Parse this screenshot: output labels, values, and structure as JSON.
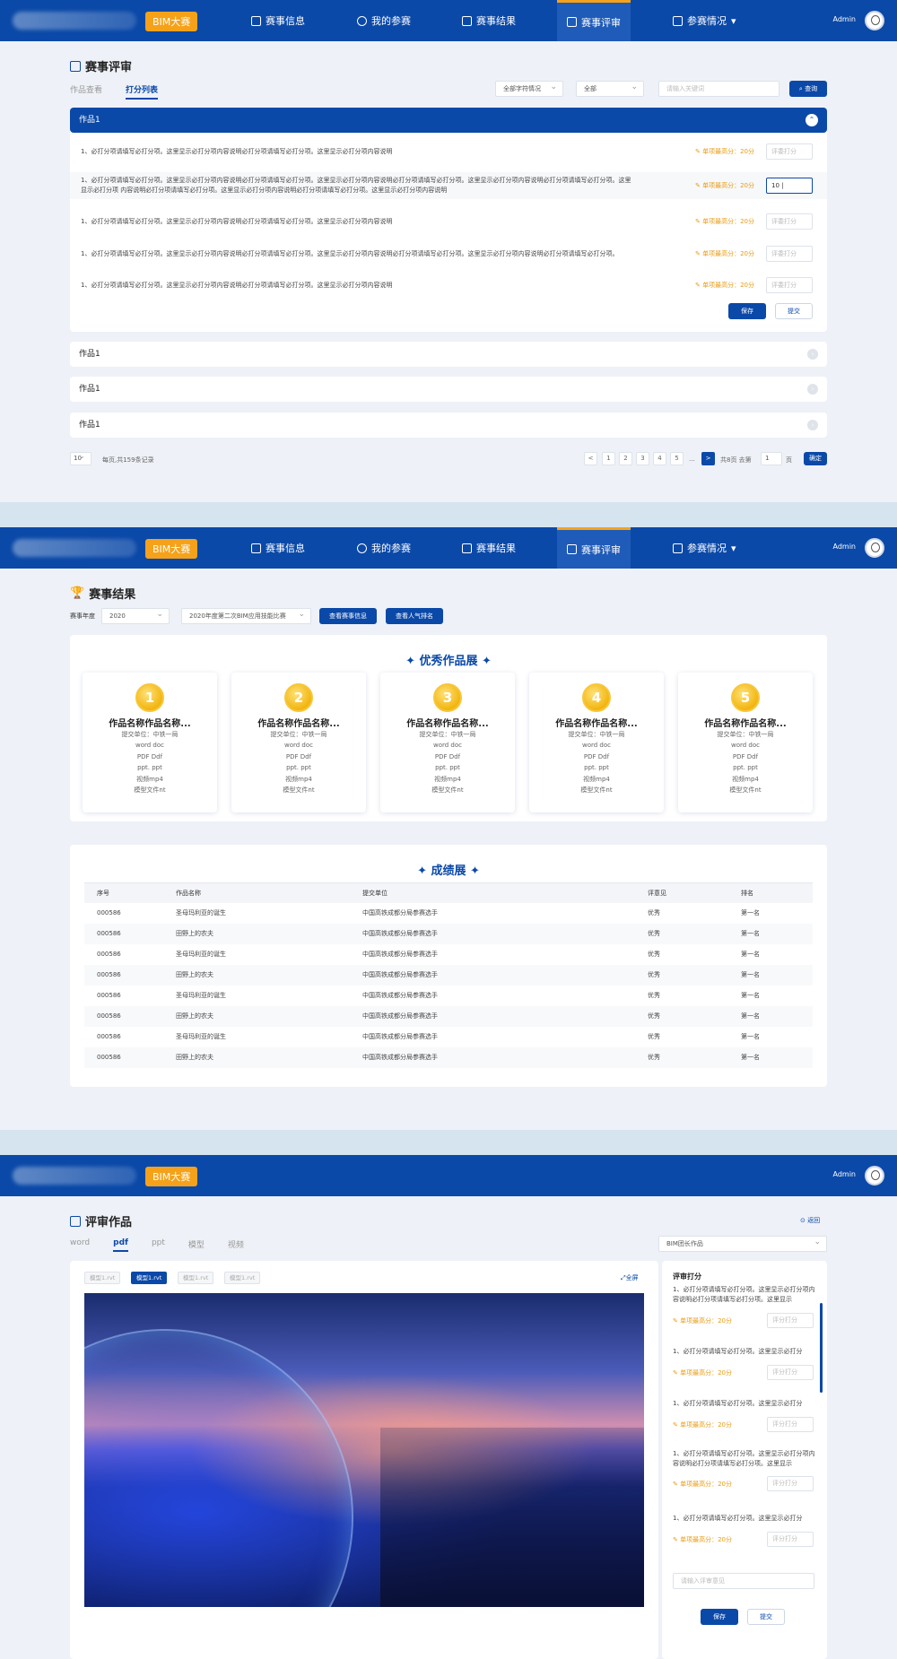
{
  "nav": {
    "badge": "BIM大赛",
    "items": [
      "赛事信息",
      "我的参赛",
      "赛事结果",
      "赛事评审",
      "参赛情况"
    ],
    "admin": "Admin"
  },
  "s1": {
    "title": "赛事评审",
    "tabs": [
      "作品查看",
      "打分列表"
    ],
    "filter1": "全部字符情况",
    "filter2": "全部",
    "search_ph": "请输入关键词",
    "search_btn": "查询",
    "open": "作品1",
    "rows": [
      {
        "text": "1、必打分项请填写必打分项。这里显示必打分项内容说明必打分项请填写必打分项。这里显示必打分项内容说明",
        "max": "单项最高分：20分",
        "score": "评委打分"
      },
      {
        "text": "1、必打分项请填写必打分项。这里显示必打分项内容说明必打分项请填写必打分项。这里显示必打分项内容说明必打分项请填写必打分项。这里显示必打分项内容说明必打分项请填写必打分项。这里显示必打分项 内容说明必打分项请填写必打分项。这里显示必打分项内容说明必打分项请填写必打分项。这里显示必打分项内容说明",
        "max": "单项最高分：20分",
        "score": "10 |"
      },
      {
        "text": "1、必打分项请填写必打分项。这里显示必打分项内容说明必打分项请填写必打分项。这里显示必打分项内容说明",
        "max": "单项最高分：20分",
        "score": "评委打分"
      },
      {
        "text": "1、必打分项请填写必打分项。这里显示必打分项内容说明必打分项请填写必打分项。这里显示必打分项内容说明必打分项请填写必打分项。这里显示必打分项内容说明必打分项请填写必打分项。",
        "max": "单项最高分：20分",
        "score": "评委打分"
      },
      {
        "text": "1、必打分项请填写必打分项。这里显示必打分项内容说明必打分项请填写必打分项。这里显示必打分项内容说明",
        "max": "单项最高分：20分",
        "score": "评委打分"
      }
    ],
    "save": "保存",
    "submit": "提交",
    "closed": [
      "作品1",
      "作品1",
      "作品1"
    ],
    "page_size": "10",
    "total_text": "每页,共159条记录",
    "pages": [
      "<",
      "1",
      "2",
      "3",
      "4",
      "5",
      "...",
      ">"
    ],
    "total_pages": "共8页 去第",
    "goto": "1",
    "page_unit": "页",
    "confirm": "确定"
  },
  "s2": {
    "title": "赛事结果",
    "year_label": "赛事年度",
    "year": "2020",
    "contest": "2020年度第二次BIM应用技能比赛",
    "btn1": "查看赛事信息",
    "btn2": "查看人气排名",
    "sec1": "优秀作品展",
    "medals": [
      {
        "rank": "1",
        "name": "作品名称作品名称...",
        "unit": "提交单位：中铁一局",
        "files": [
          "word doc",
          "PDF Ddf",
          "ppt. ppt",
          "视频mp4",
          "模型文件nt"
        ]
      },
      {
        "rank": "2",
        "name": "作品名称作品名称...",
        "unit": "提交单位：中铁一局",
        "files": [
          "word doc",
          "PDF Ddf",
          "ppt. ppt",
          "视频mp4",
          "模型文件nt"
        ]
      },
      {
        "rank": "3",
        "name": "作品名称作品名称...",
        "unit": "提交单位：中铁一局",
        "files": [
          "word doc",
          "PDF Ddf",
          "ppt. ppt",
          "视频mp4",
          "模型文件nt"
        ]
      },
      {
        "rank": "4",
        "name": "作品名称作品名称...",
        "unit": "提交单位：中铁一局",
        "files": [
          "word doc",
          "PDF Ddf",
          "ppt. ppt",
          "视频mp4",
          "模型文件nt"
        ]
      },
      {
        "rank": "5",
        "name": "作品名称作品名称...",
        "unit": "提交单位：中铁一局",
        "files": [
          "word doc",
          "PDF Ddf",
          "ppt. ppt",
          "视频mp4",
          "模型文件nt"
        ]
      }
    ],
    "sec2": "成绩展",
    "cols": [
      "序号",
      "作品名称",
      "提交单位",
      "评意见",
      "排名"
    ],
    "rows": [
      [
        "000586",
        "圣母玛利亚的诞生",
        "中国高铁成都分局参赛选手",
        "优秀",
        "第一名"
      ],
      [
        "000586",
        "田野上的农夫",
        "中国高铁成都分局参赛选手",
        "优秀",
        "第一名"
      ],
      [
        "000586",
        "圣母玛利亚的诞生",
        "中国高铁成都分局参赛选手",
        "优秀",
        "第一名"
      ],
      [
        "000586",
        "田野上的农夫",
        "中国高铁成都分局参赛选手",
        "优秀",
        "第一名"
      ],
      [
        "000586",
        "圣母玛利亚的诞生",
        "中国高铁成都分局参赛选手",
        "优秀",
        "第一名"
      ],
      [
        "000586",
        "田野上的农夫",
        "中国高铁成都分局参赛选手",
        "优秀",
        "第一名"
      ],
      [
        "000586",
        "圣母玛利亚的诞生",
        "中国高铁成都分局参赛选手",
        "优秀",
        "第一名"
      ],
      [
        "000586",
        "田野上的农夫",
        "中国高铁成都分局参赛选手",
        "优秀",
        "第一名"
      ]
    ]
  },
  "s3": {
    "title": "评审作品",
    "back": "返回",
    "tabs": [
      "word",
      "pdf",
      "ppt",
      "模型",
      "视频"
    ],
    "select": "BIM团长作品",
    "chips": [
      "模型1.rvt",
      "模型1.rvt",
      "模型1.rvt",
      "模型1.rvt"
    ],
    "fullscreen": "全屏",
    "panel_title": "评审打分",
    "items": [
      {
        "text": "1、必打分项请填写必打分项。这里显示必打分项内容说明必打分项请填写必打分项。这里显示",
        "max": "单项最高分：20分",
        "score": "评分打分"
      },
      {
        "text": "1、必打分项请填写必打分项。这里显示必打分",
        "max": "单项最高分：20分",
        "score": "评分打分"
      },
      {
        "text": "1、必打分项请填写必打分项。这里显示必打分",
        "max": "单项最高分：20分",
        "score": "评分打分"
      },
      {
        "text": "1、必打分项请填写必打分项。这里显示必打分项内容说明必打分项请填写必打分项。这里显示",
        "max": "单项最高分：20分",
        "score": "评分打分"
      },
      {
        "text": "1、必打分项请填写必打分项。这里显示必打分",
        "max": "单项最高分：20分",
        "score": "评分打分"
      }
    ],
    "comment_ph": "请输入评审意见",
    "save": "保存",
    "submit": "提交"
  }
}
